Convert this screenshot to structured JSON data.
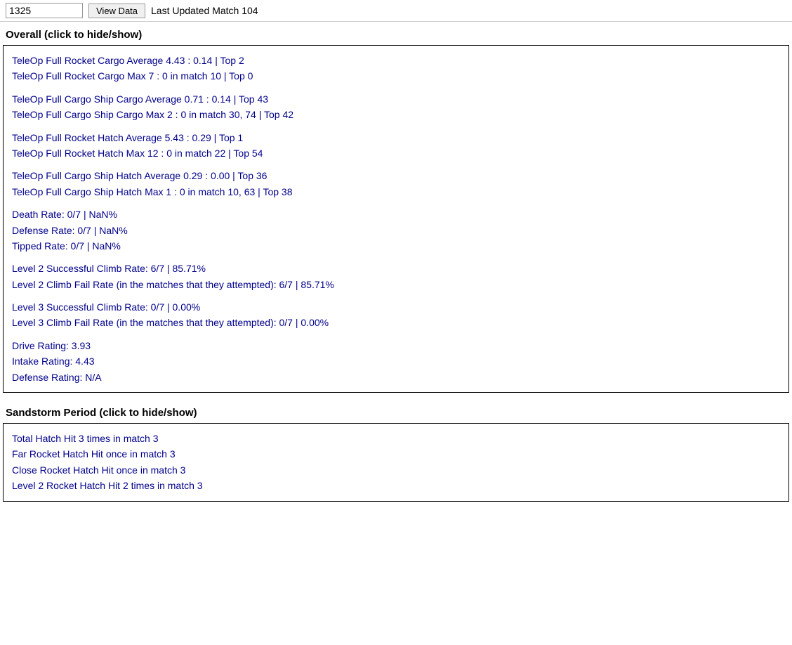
{
  "header": {
    "team_value": "1325",
    "view_data_label": "View Data",
    "last_updated": "Last Updated Match 104"
  },
  "overall_section": {
    "title": "Overall (click to hide/show)",
    "groups": [
      {
        "lines": [
          "TeleOp Full Rocket Cargo Average 4.43 : 0.14 | Top 2",
          "TeleOp Full Rocket Cargo Max 7 : 0 in match 10 | Top 0"
        ]
      },
      {
        "lines": [
          "TeleOp Full Cargo Ship Cargo Average 0.71 : 0.14 | Top 43",
          "TeleOp Full Cargo Ship Cargo Max 2 : 0 in match 30, 74 | Top 42"
        ]
      },
      {
        "lines": [
          "TeleOp Full Rocket Hatch Average 5.43 : 0.29 | Top 1",
          "TeleOp Full Rocket Hatch Max 12 : 0 in match 22 | Top 54"
        ]
      },
      {
        "lines": [
          "TeleOp Full Cargo Ship Hatch Average 0.29 : 0.00 | Top 36",
          "TeleOp Full Cargo Ship Hatch Max 1 : 0 in match 10, 63 | Top 38"
        ]
      },
      {
        "lines": [
          "Death Rate: 0/7 | NaN%",
          "Defense Rate: 0/7 | NaN%",
          "Tipped Rate: 0/7 | NaN%"
        ]
      },
      {
        "lines": [
          "Level 2 Successful Climb Rate: 6/7 | 85.71%",
          "Level 2 Climb Fail Rate (in the matches that they attempted): 6/7 | 85.71%"
        ]
      },
      {
        "lines": [
          "Level 3 Successful Climb Rate: 0/7 | 0.00%",
          "Level 3 Climb Fail Rate (in the matches that they attempted): 0/7 | 0.00%"
        ]
      },
      {
        "lines": [
          "Drive Rating: 3.93",
          "Intake Rating: 4.43",
          "Defense Rating: N/A"
        ]
      }
    ]
  },
  "sandstorm_section": {
    "title": "Sandstorm Period (click to hide/show)",
    "groups": [
      {
        "lines": [
          "Total Hatch Hit 3 times in match 3",
          "Far Rocket Hatch Hit once in match 3",
          "Close Rocket Hatch Hit once in match 3",
          "Level 2 Rocket Hatch Hit 2 times in match 3"
        ]
      }
    ]
  }
}
